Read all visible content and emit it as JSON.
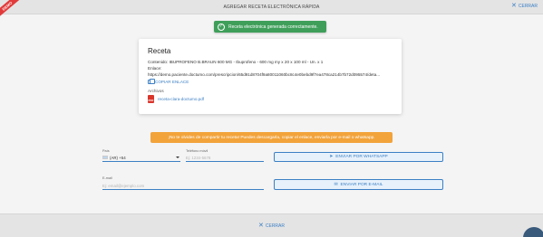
{
  "ribbon": {
    "label": "DEMO"
  },
  "header": {
    "title": "AGREGAR RECETA ELECTRÓNICA RÁPIDA",
    "close_label": "CERRAR",
    "close_icon": "close-icon"
  },
  "toast": {
    "message": "Receta electrónica generada correctamente.",
    "icon": "check-circle-icon",
    "color": "#3f9f5a"
  },
  "receta": {
    "title": "Receta",
    "contenido": "Contenido: IBUPROFENO B.BRAUN 600 MG - Ibuprofeno - 600 mg my x 20 x 100 ml - Un. x 1",
    "enlace_label": "Enlace:",
    "enlace_url": "https://demo.paciente.doctumo.com/prescripcion/65d91d8704f9a80011060bc8c4e0bebd9f7ea478ca214b7b72d095574/deta...",
    "copy_label": "COPIAR ENLACE",
    "archivos_label": "Archivos",
    "file_name": "receta-clara-doctumo.pdf",
    "file_icon": "pdf-file-icon"
  },
  "warning": {
    "message": "¡No te olvides de compartir tu receta! Puedes descargarla, copiar el enlace, enviarla por e-mail o whatsapp.",
    "icon": "warning-icon",
    "color": "#f2a33a"
  },
  "whatsapp_form": {
    "country_label": "País",
    "country_value": "(AR) +54",
    "phone_label": "Teléfono móvil",
    "phone_placeholder": "Ej: 1234-5678",
    "button_label": "ENVIAR POR WHATSAPP",
    "button_icon": "send-icon"
  },
  "email_form": {
    "email_label": "E-mail",
    "email_placeholder": "Ej: email@ejemplo.com",
    "button_label": "ENVIAR POR E-MAIL",
    "button_icon": "mail-icon"
  },
  "footer": {
    "close_label": "CERRAR"
  },
  "colors": {
    "accent": "#3b7fc4",
    "success": "#3f9f5a",
    "warning": "#f2a33a",
    "ribbon": "#e23b3b"
  }
}
